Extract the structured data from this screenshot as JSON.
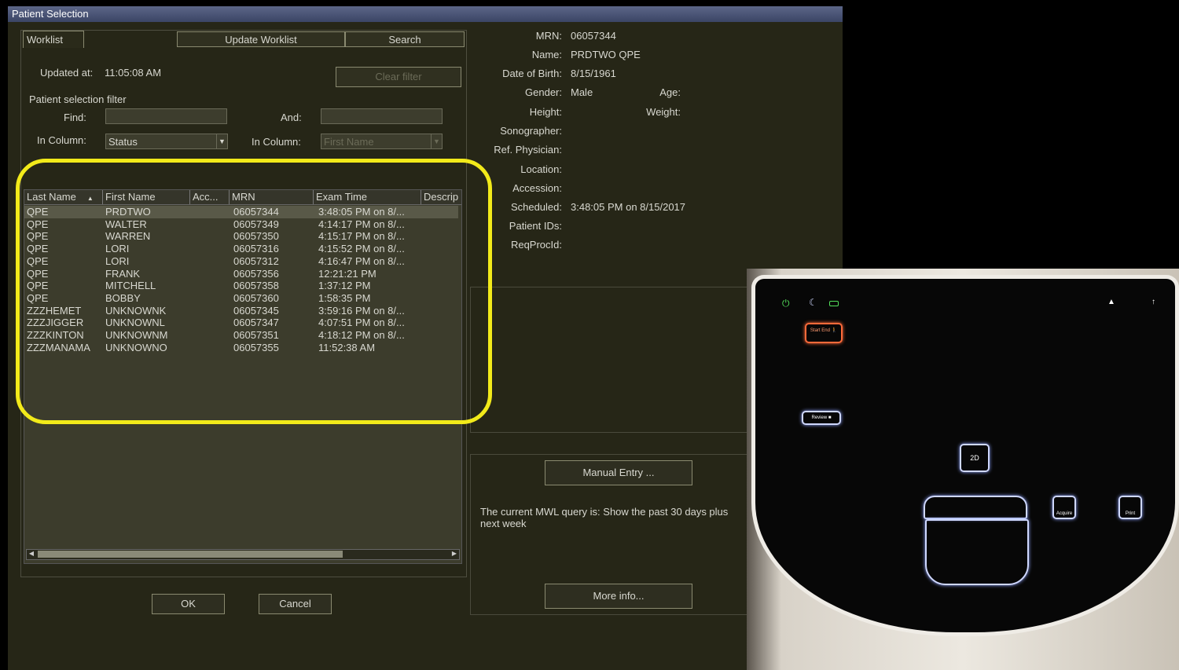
{
  "window": {
    "title": "Patient Selection"
  },
  "worklist": {
    "tab_label": "Worklist",
    "update_button": "Update Worklist",
    "search_button": "Search",
    "updated_at_label": "Updated at:",
    "updated_at_value": "11:05:08 AM",
    "clear_filter_button": "Clear filter",
    "filter_group_label": "Patient selection filter",
    "find_label": "Find:",
    "and_label": "And:",
    "in_column_label_1": "In Column:",
    "in_column_value_1": "Status",
    "in_column_label_2": "In Column:",
    "in_column_value_2": "First Name",
    "columns": [
      "Last Name",
      "First Name",
      "Acc...",
      "MRN",
      "Exam Time",
      "Descrip"
    ],
    "rows": [
      {
        "last": "QPE",
        "first": "PRDTWO",
        "mrn": "06057344",
        "time": "3:48:05 PM on 8/..."
      },
      {
        "last": "QPE",
        "first": "WALTER",
        "mrn": "06057349",
        "time": "4:14:17 PM on 8/..."
      },
      {
        "last": "QPE",
        "first": "WARREN",
        "mrn": "06057350",
        "time": "4:15:17 PM on 8/..."
      },
      {
        "last": "QPE",
        "first": "LORI",
        "mrn": "06057316",
        "time": "4:15:52 PM on 8/..."
      },
      {
        "last": "QPE",
        "first": "LORI",
        "mrn": "06057312",
        "time": "4:16:47 PM on 8/..."
      },
      {
        "last": "QPE",
        "first": "FRANK",
        "mrn": "06057356",
        "time": "12:21:21 PM"
      },
      {
        "last": "QPE",
        "first": "MITCHELL",
        "mrn": "06057358",
        "time": "1:37:12 PM"
      },
      {
        "last": "QPE",
        "first": "BOBBY",
        "mrn": "06057360",
        "time": "1:58:35 PM"
      },
      {
        "last": "ZZZHEMET",
        "first": "UNKNOWNK",
        "mrn": "06057345",
        "time": "3:59:16 PM on 8/..."
      },
      {
        "last": "ZZZJIGGER",
        "first": "UNKNOWNL",
        "mrn": "06057347",
        "time": "4:07:51 PM on 8/..."
      },
      {
        "last": "ZZZKINTON",
        "first": "UNKNOWNM",
        "mrn": "06057351",
        "time": "4:18:12 PM on 8/..."
      },
      {
        "last": "ZZZMANAMA",
        "first": "UNKNOWNO",
        "mrn": "06057355",
        "time": "11:52:38 AM"
      }
    ]
  },
  "buttons": {
    "ok": "OK",
    "cancel": "Cancel",
    "manual_entry": "Manual Entry ...",
    "more_info": "More info..."
  },
  "patient": {
    "mrn_label": "MRN:",
    "mrn": "06057344",
    "name_label": "Name:",
    "name": "PRDTWO QPE",
    "dob_label": "Date of Birth:",
    "dob": "8/15/1961",
    "gender_label": "Gender:",
    "gender": "Male",
    "age_label": "Age:",
    "height_label": "Height:",
    "weight_label": "Weight:",
    "sonographer_label": "Sonographer:",
    "ref_physician_label": "Ref. Physician:",
    "location_label": "Location:",
    "accession_label": "Accession:",
    "scheduled_label": "Scheduled:",
    "scheduled": "3:48:05 PM on 8/15/2017",
    "patient_ids_label": "Patient IDs:",
    "reqprocid_label": "ReqProcId:"
  },
  "mwl_query_text": "The current MWL query is: Show the past 30 days plus next week",
  "device_panel": {
    "start_end_label": "Start End",
    "review_label": "Review",
    "mode_label": "2D",
    "acquire_label": "Acquire",
    "print_label": "Print"
  },
  "colors": {
    "highlight": "#f2ea1a",
    "window_bg": "#262617",
    "title_bar": "#4a5478"
  }
}
